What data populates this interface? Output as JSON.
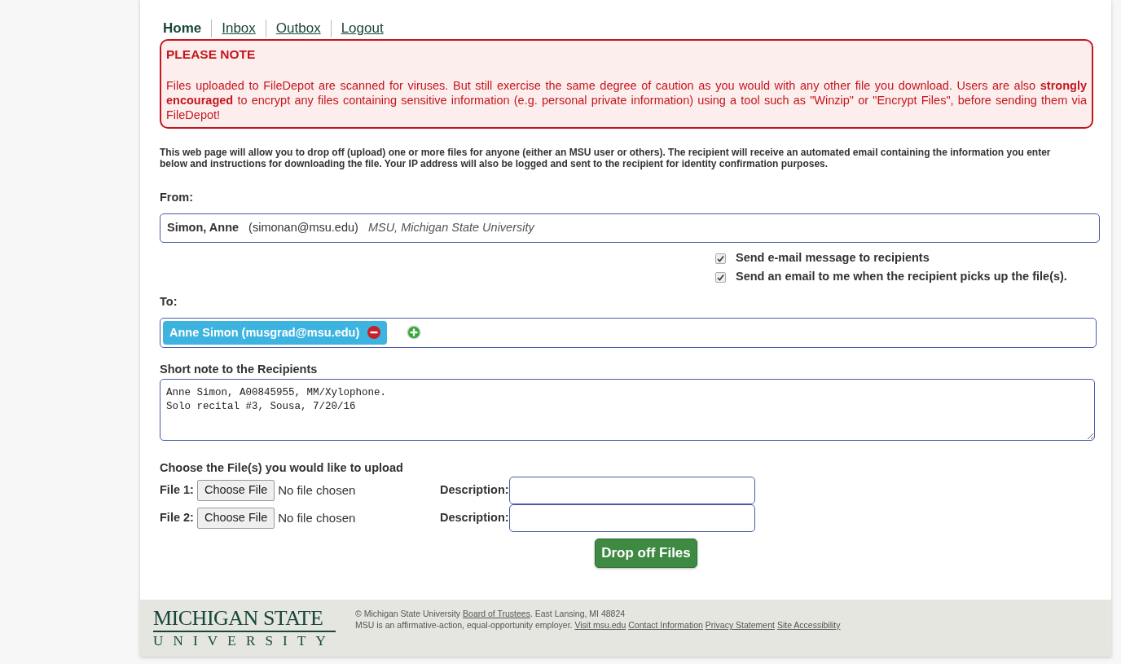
{
  "nav": [
    {
      "label": "Home",
      "selected": true
    },
    {
      "label": "Inbox",
      "selected": false
    },
    {
      "label": "Outbox",
      "selected": false
    },
    {
      "label": "Logout",
      "selected": false
    }
  ],
  "notice": {
    "title": "PLEASE NOTE",
    "text": "Files uploaded to FileDepot are scanned for viruses. But still exercise the same degree of caution as you would with any other file you download. Users are also **strongly encouraged** to encrypt any files containing sensitive information (e.g. personal private information) using a tool such as \"Winzip\" or \"Encrypt Files\", before sending them via FileDepot!"
  },
  "intro": "This web page will allow you to drop off (upload) one or more files for anyone (either an MSU user or others). The recipient will receive an automated email containing the information you enter below and instructions for downloading the file. Your IP address will also be logged and sent to the recipient for identity confirmation purposes.",
  "from": {
    "label": "From:",
    "name": "Simon, Anne",
    "email": "(simonan@msu.edu)",
    "affiliation": "MSU, Michigan State University"
  },
  "options": [
    {
      "label": "Send e-mail message to recipients",
      "checked": true
    },
    {
      "label": "Send an email to me when the recipient picks up the file(s).",
      "checked": true
    }
  ],
  "to": {
    "label": "To:",
    "recipients": [
      "Anne Simon (musgrad@msu.edu)"
    ]
  },
  "note": {
    "label": "Short note to the Recipients",
    "value": "Anne Simon, A00845955, MM/Xylophone.\nSolo recital #3, Sousa, 7/20/16"
  },
  "files": {
    "heading": "Choose the File(s) you would like to upload",
    "rows": [
      {
        "label": "File 1:",
        "button": "Choose File",
        "status": "No file chosen",
        "description_label": "Description:"
      },
      {
        "label": "File 2:",
        "button": "Choose File",
        "status": "No file chosen",
        "description_label": "Description:"
      }
    ]
  },
  "submit": "Drop off Files",
  "footer": {
    "logo_top": "MICHIGAN STATE",
    "logo_bottom": "UNIVERSITY",
    "line1": {
      "before": "© Michigan State University ",
      "link": "Board of Trustees",
      "after": ". East Lansing, MI 48824"
    },
    "line2": {
      "text": "MSU is an affirmative-action, equal-opportunity employer.",
      "links": [
        "Visit msu.edu",
        "Contact Information",
        "Privacy Statement",
        "Site Accessibility"
      ]
    }
  }
}
